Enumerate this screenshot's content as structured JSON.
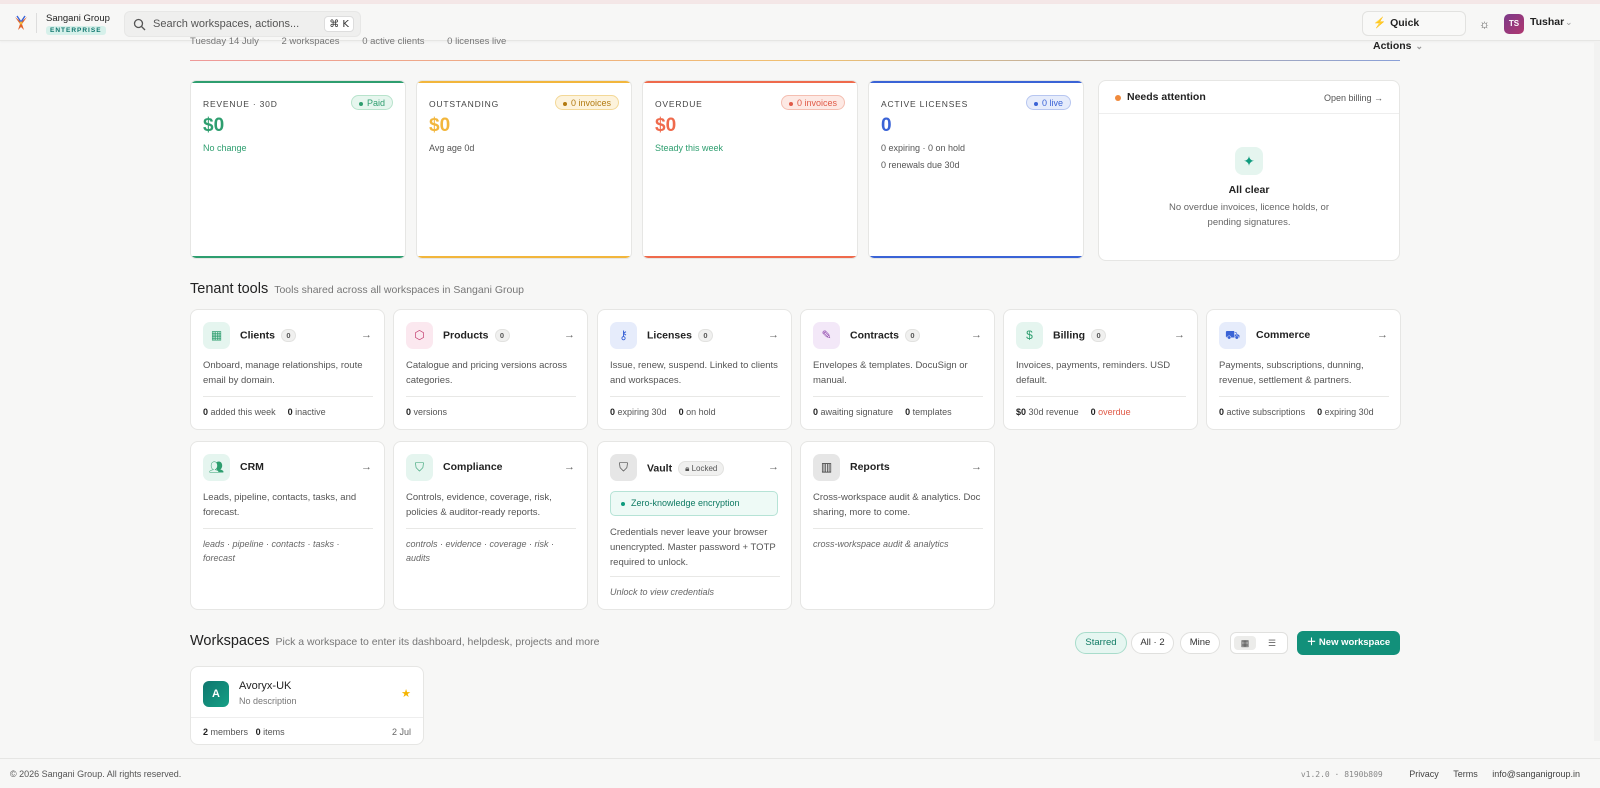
{
  "header": {
    "brand_name": "Sangani Group",
    "brand_tier": "ENTERPRISE",
    "search_placeholder": "Search workspaces, actions...",
    "search_shortcut": "⌘ K",
    "quick_actions_label": "Quick Actions",
    "user_initials": "TS",
    "user_name": "Tushar"
  },
  "summary": {
    "date": "Tuesday 14 July",
    "workspaces": "2 workspaces",
    "clients": "0 active clients",
    "licenses": "0 licenses live"
  },
  "kpis": {
    "revenue": {
      "label": "REVENUE · 30D",
      "badge": "Paid",
      "value": "$0",
      "sub": "No change",
      "color": "#2e9e6f"
    },
    "outstanding": {
      "label": "OUTSTANDING",
      "badge": "0 invoices",
      "value": "$0",
      "sub": "Avg age 0d",
      "color": "#f2b63c"
    },
    "overdue": {
      "label": "OVERDUE",
      "badge": "0 invoices",
      "value": "$0",
      "sub": "Steady this week",
      "color": "#ef6a4c"
    },
    "licenses": {
      "label": "ACTIVE LICENSES",
      "badge": "0 live",
      "value": "0",
      "sub": "0 expiring · 0 on hold",
      "sub2": "0 renewals due 30d",
      "color": "#3a63d6"
    }
  },
  "attention": {
    "title": "Needs attention",
    "link": "Open billing →",
    "status": "All clear",
    "desc": "No overdue invoices, licence holds, or pending signatures."
  },
  "tenant_tools": {
    "title": "Tenant tools",
    "subtitle": "Tools shared across all workspaces in Sangani Group",
    "items": [
      {
        "name": "Clients",
        "count": "0",
        "desc": "Onboard, manage relationships, route email by domain.",
        "f1n": "0",
        "f1": "added this week",
        "f2n": "0",
        "f2": "inactive"
      },
      {
        "name": "Products",
        "count": "0",
        "desc": "Catalogue and pricing versions across categories.",
        "f1n": "0",
        "f1": "versions"
      },
      {
        "name": "Licenses",
        "count": "0",
        "desc": "Issue, renew, suspend. Linked to clients and workspaces.",
        "f1n": "0",
        "f1": "expiring 30d",
        "f2n": "0",
        "f2": "on hold"
      },
      {
        "name": "Contracts",
        "count": "0",
        "desc": "Envelopes & templates. DocuSign or manual.",
        "f1n": "0",
        "f1": "awaiting signature",
        "f2n": "0",
        "f2": "templates"
      },
      {
        "name": "Billing",
        "count": "0",
        "desc": "Invoices, payments, reminders. USD default.",
        "f1n": "$0",
        "f1": "30d revenue",
        "f2n": "0",
        "f2": "overdue"
      },
      {
        "name": "Commerce",
        "desc": "Payments, subscriptions, dunning, revenue, settlement & partners.",
        "f1n": "0",
        "f1": "active subscriptions",
        "f2n": "0",
        "f2": "expiring 30d"
      },
      {
        "name": "CRM",
        "desc": "Leads, pipeline, contacts, tasks, and forecast.",
        "tags": "leads · pipeline · contacts · tasks · forecast"
      },
      {
        "name": "Compliance",
        "desc": "Controls, evidence, coverage, risk, policies & auditor-ready reports.",
        "tags": "controls · evidence · coverage · risk · audits"
      },
      {
        "name": "Vault",
        "lock": "Locked",
        "zk": "Zero-knowledge encryption",
        "desc": "Credentials never leave your browser unencrypted. Master password + TOTP required to unlock.",
        "tags": "Unlock to view credentials"
      },
      {
        "name": "Reports",
        "desc": "Cross-workspace audit & analytics. Doc sharing, more to come.",
        "tags": "cross-workspace audit & analytics"
      }
    ]
  },
  "workspaces": {
    "title": "Workspaces",
    "subtitle": "Pick a workspace to enter its dashboard, helpdesk, projects and more",
    "filters": [
      "Starred",
      "All · 2",
      "Mine"
    ],
    "new_label": "New workspace",
    "items": [
      {
        "initial": "A",
        "name": "Avoryx-UK",
        "desc": "No description",
        "members_n": "2",
        "members": "members",
        "items_n": "0",
        "items": "items",
        "date": "2 Jul"
      }
    ]
  },
  "footer": {
    "copyright": "© 2026 Sangani Group. All rights reserved.",
    "version": "v1.2.0 · 8190b809",
    "privacy": "Privacy",
    "terms": "Terms",
    "email": "info@sanganigroup.in"
  }
}
